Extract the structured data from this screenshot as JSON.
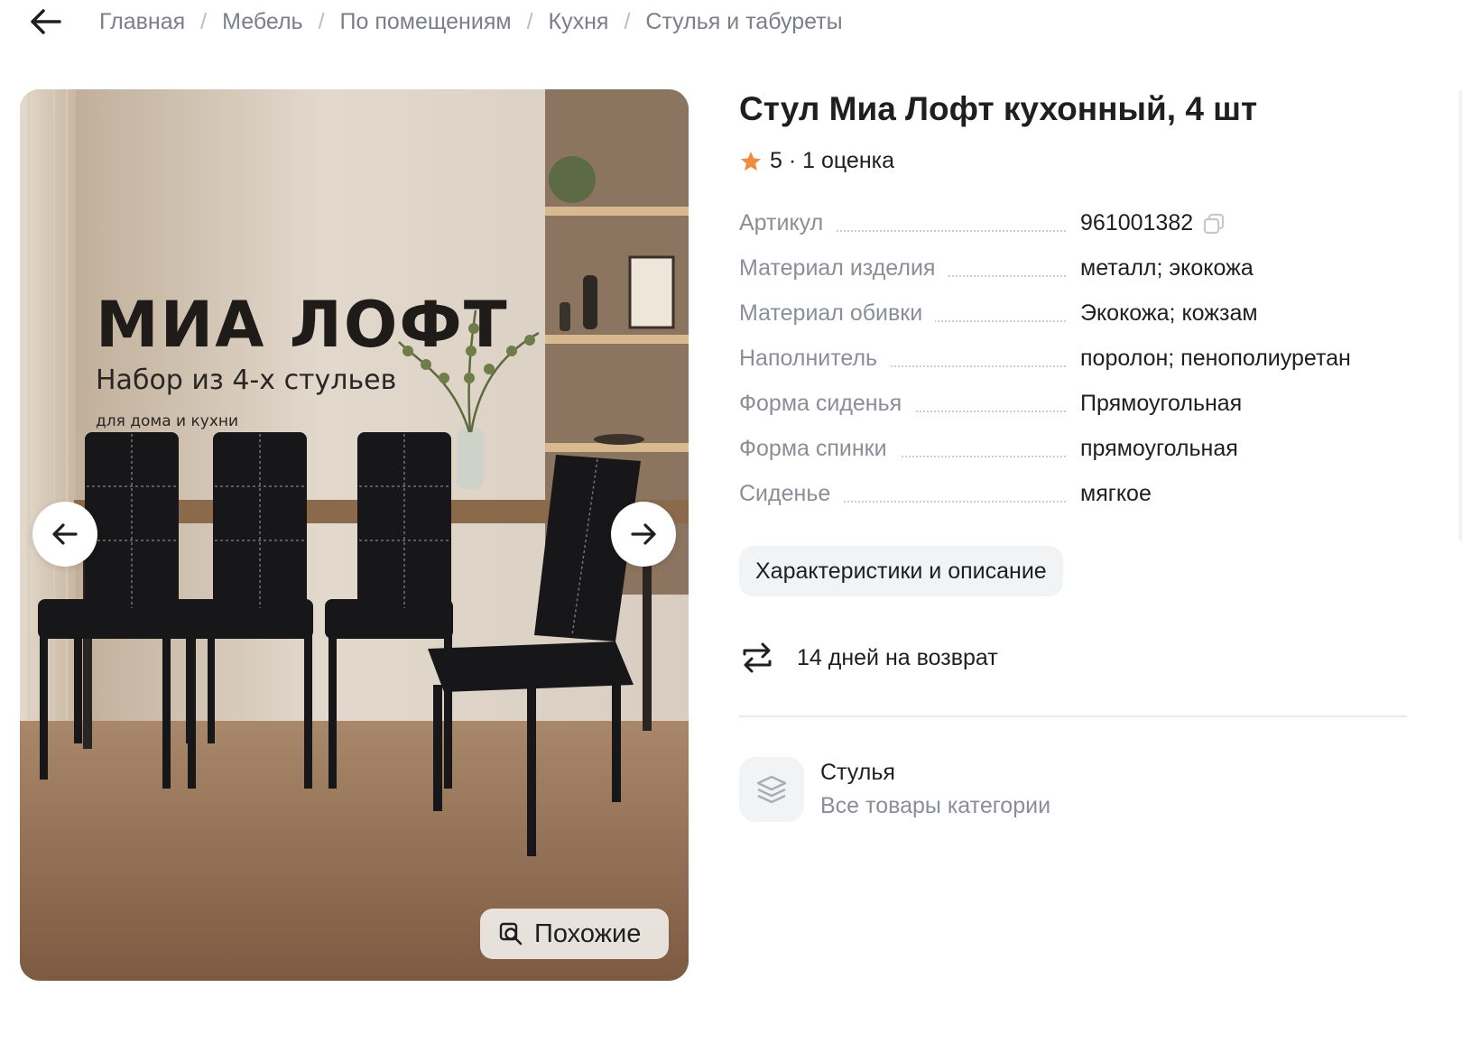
{
  "breadcrumb": {
    "items": [
      "Главная",
      "Мебель",
      "По помещениям",
      "Кухня",
      "Стулья и табуреты"
    ],
    "separator": "/"
  },
  "gallery": {
    "hero_title": "МИА ЛОФТ",
    "hero_subtitle": "Набор из 4-х стульев",
    "hero_note": "для дома и кухни",
    "similar_label": "Похожие"
  },
  "product": {
    "title": "Стул Миа Лофт кухонный, 4 шт",
    "rating": "5 · 1 оценка",
    "rating_star_color": "#f08a3c",
    "specs": [
      {
        "label": "Артикул",
        "value": "961001382"
      },
      {
        "label": "Материал изделия",
        "value": "металл; экокожа"
      },
      {
        "label": "Материал обивки",
        "value": "Экокожа; кожзам"
      },
      {
        "label": "Наполнитель",
        "value": "поролон; пенополиуретан"
      },
      {
        "label": "Форма сиденья",
        "value": "Прямоугольная"
      },
      {
        "label": "Форма спинки",
        "value": "прямоугольная"
      },
      {
        "label": "Сиденье",
        "value": "мягкое"
      }
    ],
    "characteristics_button": "Характеристики и описание",
    "returns_text": "14 дней на возврат"
  },
  "category": {
    "name": "Стулья",
    "link": "Все товары категории"
  },
  "icons": [
    "back-arrow-icon",
    "arrow-left-icon",
    "arrow-right-icon",
    "similar-search-icon",
    "star-icon",
    "copy-icon",
    "return-arrows-icon",
    "layers-icon"
  ]
}
